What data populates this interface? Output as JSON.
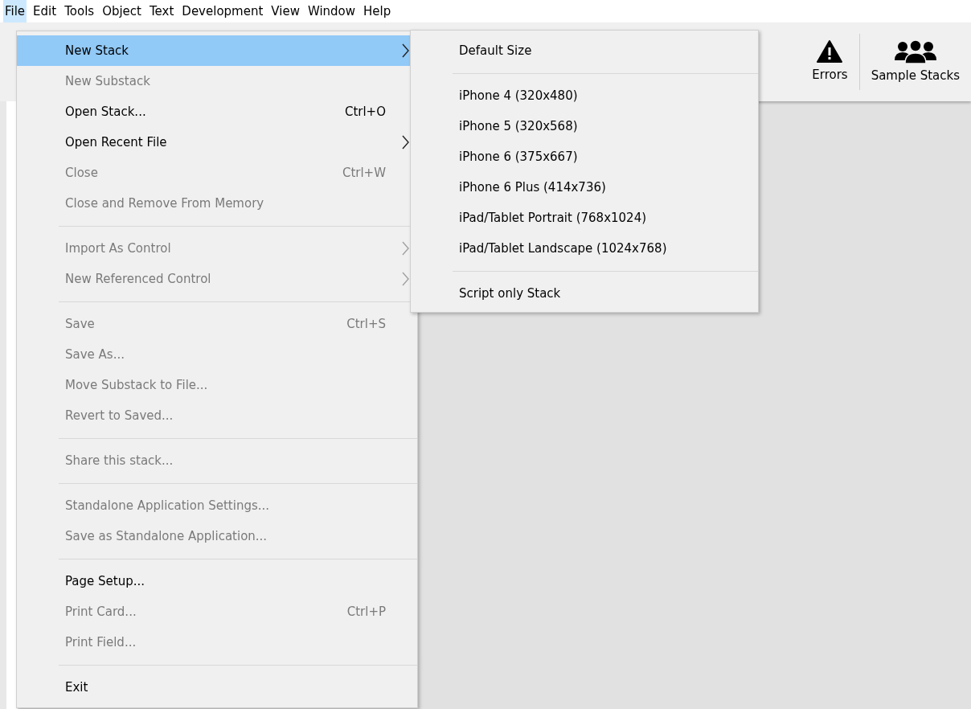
{
  "menubar": [
    {
      "label": "File",
      "selected": true
    },
    {
      "label": "Edit",
      "selected": false
    },
    {
      "label": "Tools",
      "selected": false
    },
    {
      "label": "Object",
      "selected": false
    },
    {
      "label": "Text",
      "selected": false
    },
    {
      "label": "Development",
      "selected": false
    },
    {
      "label": "View",
      "selected": false
    },
    {
      "label": "Window",
      "selected": false
    },
    {
      "label": "Help",
      "selected": false
    }
  ],
  "toolbar": [
    {
      "label": "Errors",
      "kind": "warning"
    },
    {
      "label": "Sample Stacks",
      "kind": "people"
    }
  ],
  "file_menu": [
    {
      "kind": "item",
      "label": "New Stack",
      "submenu": true,
      "disabled": false,
      "selected": true
    },
    {
      "kind": "item",
      "label": "New Substack",
      "submenu": false,
      "disabled": true,
      "selected": false
    },
    {
      "kind": "item",
      "label": "Open Stack...",
      "shortcut": "Ctrl+O",
      "submenu": false,
      "disabled": false,
      "selected": false
    },
    {
      "kind": "item",
      "label": "Open Recent File",
      "submenu": true,
      "disabled": false,
      "selected": false
    },
    {
      "kind": "item",
      "label": "Close",
      "shortcut": "Ctrl+W",
      "submenu": false,
      "disabled": true,
      "selected": false
    },
    {
      "kind": "item",
      "label": "Close and Remove From Memory",
      "submenu": false,
      "disabled": true,
      "selected": false
    },
    {
      "kind": "separator"
    },
    {
      "kind": "item",
      "label": "Import As Control",
      "submenu": true,
      "disabled": true,
      "selected": false
    },
    {
      "kind": "item",
      "label": "New Referenced Control",
      "submenu": true,
      "disabled": true,
      "selected": false
    },
    {
      "kind": "separator"
    },
    {
      "kind": "item",
      "label": "Save",
      "shortcut": "Ctrl+S",
      "submenu": false,
      "disabled": true,
      "selected": false
    },
    {
      "kind": "item",
      "label": "Save As...",
      "submenu": false,
      "disabled": true,
      "selected": false
    },
    {
      "kind": "item",
      "label": "Move Substack to File...",
      "submenu": false,
      "disabled": true,
      "selected": false
    },
    {
      "kind": "item",
      "label": "Revert to Saved...",
      "submenu": false,
      "disabled": true,
      "selected": false
    },
    {
      "kind": "separator"
    },
    {
      "kind": "item",
      "label": "Share this stack...",
      "submenu": false,
      "disabled": true,
      "selected": false
    },
    {
      "kind": "separator"
    },
    {
      "kind": "item",
      "label": "Standalone Application Settings...",
      "submenu": false,
      "disabled": true,
      "selected": false
    },
    {
      "kind": "item",
      "label": "Save as Standalone Application...",
      "submenu": false,
      "disabled": true,
      "selected": false
    },
    {
      "kind": "separator"
    },
    {
      "kind": "item",
      "label": "Page Setup...",
      "submenu": false,
      "disabled": false,
      "selected": false
    },
    {
      "kind": "item",
      "label": "Print Card...",
      "shortcut": "Ctrl+P",
      "submenu": false,
      "disabled": true,
      "selected": false
    },
    {
      "kind": "item",
      "label": "Print Field...",
      "submenu": false,
      "disabled": true,
      "selected": false
    },
    {
      "kind": "separator"
    },
    {
      "kind": "item",
      "label": "Exit",
      "submenu": false,
      "disabled": false,
      "selected": false
    }
  ],
  "new_stack_submenu": [
    {
      "kind": "item",
      "label": "Default Size",
      "submenu": false,
      "disabled": false,
      "selected": false
    },
    {
      "kind": "separator"
    },
    {
      "kind": "item",
      "label": "iPhone 4 (320x480)",
      "submenu": false,
      "disabled": false,
      "selected": false
    },
    {
      "kind": "item",
      "label": "iPhone 5 (320x568)",
      "submenu": false,
      "disabled": false,
      "selected": false
    },
    {
      "kind": "item",
      "label": "iPhone 6 (375x667)",
      "submenu": false,
      "disabled": false,
      "selected": false
    },
    {
      "kind": "item",
      "label": "iPhone 6 Plus (414x736)",
      "submenu": false,
      "disabled": false,
      "selected": false
    },
    {
      "kind": "item",
      "label": "iPad/Tablet Portrait (768x1024)",
      "submenu": false,
      "disabled": false,
      "selected": false
    },
    {
      "kind": "item",
      "label": "iPad/Tablet Landscape (1024x768)",
      "submenu": false,
      "disabled": false,
      "selected": false
    },
    {
      "kind": "separator"
    },
    {
      "kind": "item",
      "label": "Script only Stack",
      "submenu": false,
      "disabled": false,
      "selected": false
    }
  ]
}
